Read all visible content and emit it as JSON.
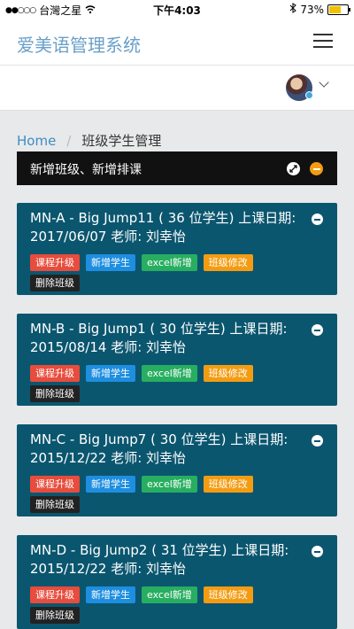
{
  "status_bar": {
    "carrier": "台灣之星",
    "time": "下午4:03",
    "battery": "73%",
    "battery_level": 0.73
  },
  "app": {
    "title": "爱美语管理系统"
  },
  "breadcrumb": {
    "home": "Home",
    "current": "班级学生管理"
  },
  "panel": {
    "title": "新增班级、新增排课"
  },
  "actions": {
    "upgrade": "课程升级",
    "add_student": "新增学生",
    "excel_add": "excel新增",
    "edit_class": "班级修改",
    "delete_class": "删除班级"
  },
  "classes": [
    {
      "title": "MN-A - Big Jump11 ( 36 位学生) 上课日期: 2017/06/07 老师: 刘幸怡"
    },
    {
      "title": "MN-B - Big Jump1 ( 30 位学生) 上课日期: 2015/08/14 老师: 刘幸怡"
    },
    {
      "title": "MN-C - Big Jump7 ( 30 位学生) 上课日期: 2015/12/22 老师: 刘幸怡"
    },
    {
      "title": "MN-D - Big Jump2 ( 31 位学生) 上课日期: 2015/12/22 老师: 刘幸怡"
    }
  ]
}
